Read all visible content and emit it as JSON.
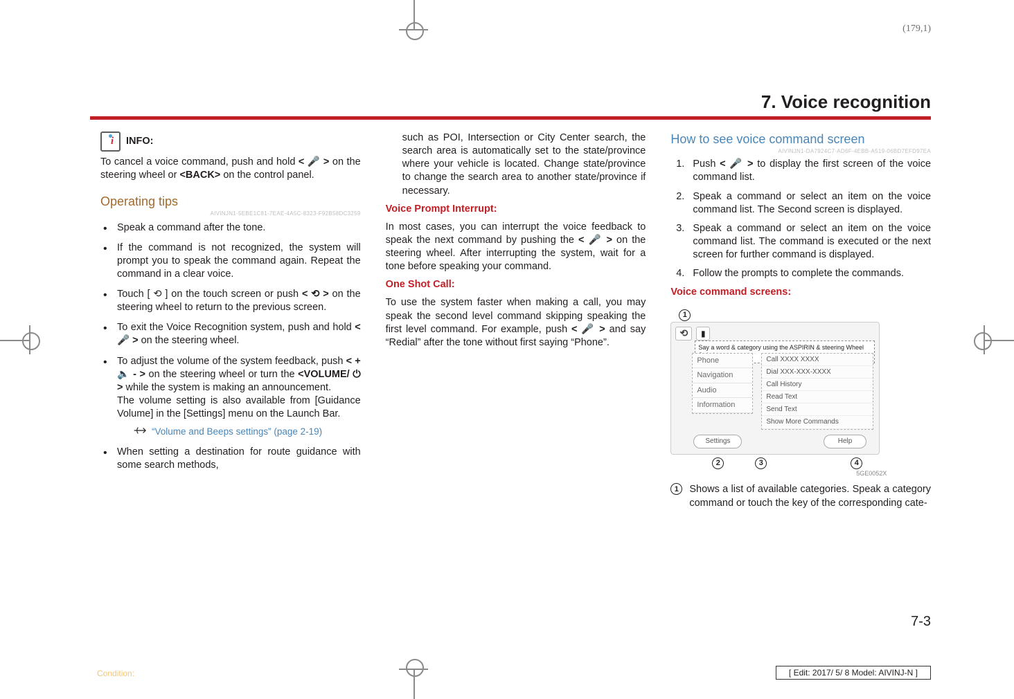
{
  "meta": {
    "page_coord": "(179,1)",
    "chapter_title": "7. Voice recognition",
    "page_number": "7-3",
    "footer_condition": "Condition:",
    "footer_edit": "[ Edit: 2017/ 5/ 8    Model:  AIVINJ-N ]"
  },
  "col1": {
    "info_label": "INFO:",
    "info_body_1": "To cancel a voice command, push and hold ",
    "info_body_2": " on the steering wheel or ",
    "info_body_3": " on the control panel.",
    "back_label": "<BACK>",
    "op_tips_heading": "Operating tips",
    "op_tips_guid": "AIVINJN1-5EBE1C81-7EAE-4A5C-8323-F92B58DC3259",
    "b1": "Speak a command after the tone.",
    "b2": "If the command is not recognized, the system will prompt you to speak the command again. Repeat the command in a clear voice.",
    "b3_a": "Touch [ ",
    "b3_b": " ] on the touch screen or push ",
    "b3_c": " on the steering wheel to return to the previous screen.",
    "b4_a": "To exit the Voice Recognition system, push and hold ",
    "b4_b": " on the steering wheel.",
    "b5_a": "To adjust the volume of the system feedback, push ",
    "b5_b": " on the steering wheel or turn the ",
    "b5_vol": "<VOLUME/ ⏻ >",
    "b5_c": " while the system is making an announcement.",
    "b5_note": "The volume setting is also available from [Guidance Volume] in the [Settings] menu on the Launch Bar.",
    "link_text": "“Volume and Beeps settings” (page 2-19)",
    "b6": "When setting a destination for route guidance with some search methods,"
  },
  "col2": {
    "p1": "such as POI, Intersection or City Center search, the search area is automatically set to the state/province where your vehicle is located. Change state/province to change the search area to another state/province if necessary.",
    "h_vpi": "Voice Prompt Interrupt:",
    "vpi_a": "In most cases, you can interrupt the voice feedback to speak the next command by pushing the ",
    "vpi_b": " on the steering wheel. After interrupting the system, wait for a tone before speaking your command.",
    "h_osc": "One Shot Call:",
    "osc_a": "To use the system faster when making a call, you may speak the second level command skipping speaking the first level command. For example, push ",
    "osc_b": " and say “Redial” after the tone without first saying “Phone”."
  },
  "col3": {
    "h1": "How to see voice command screen",
    "guid": "AIVINJN1-DA7924C7-AD6F-4EBB-A519-06BD7EFD97EA",
    "s1_a": "Push ",
    "s1_b": " to display the first screen of the voice command list.",
    "s2": "Speak a command or select an item on the voice command list. The Second screen is displayed.",
    "s3": "Speak a command or select an item on the voice command list. The command is executed or the next screen for further command is displayed.",
    "s4": "Follow the prompts to complete the commands.",
    "h_vcs": "Voice command screens:",
    "shot_hint": "Say a word & category using the ASPIRIN & steering Wheel Switch",
    "left_items": [
      "Phone",
      "Navigation",
      "Audio",
      "Information"
    ],
    "right_items": [
      "Call XXXX XXXX",
      "Dial XXX-XXX-XXXX",
      "Call History",
      "Read Text",
      "Send Text",
      "Show More Commands"
    ],
    "settings_btn": "Settings",
    "help_btn": "Help",
    "shot_code": "5GE0052X",
    "after_shot": "Shows a list of available categories. Speak a category command or touch the key of the corresponding cate-"
  },
  "glyphs": {
    "talk": "< 🎤 >",
    "back": "< ⟲ >",
    "back_icon": "⟲",
    "vol": "< + 🔈  -  >"
  }
}
